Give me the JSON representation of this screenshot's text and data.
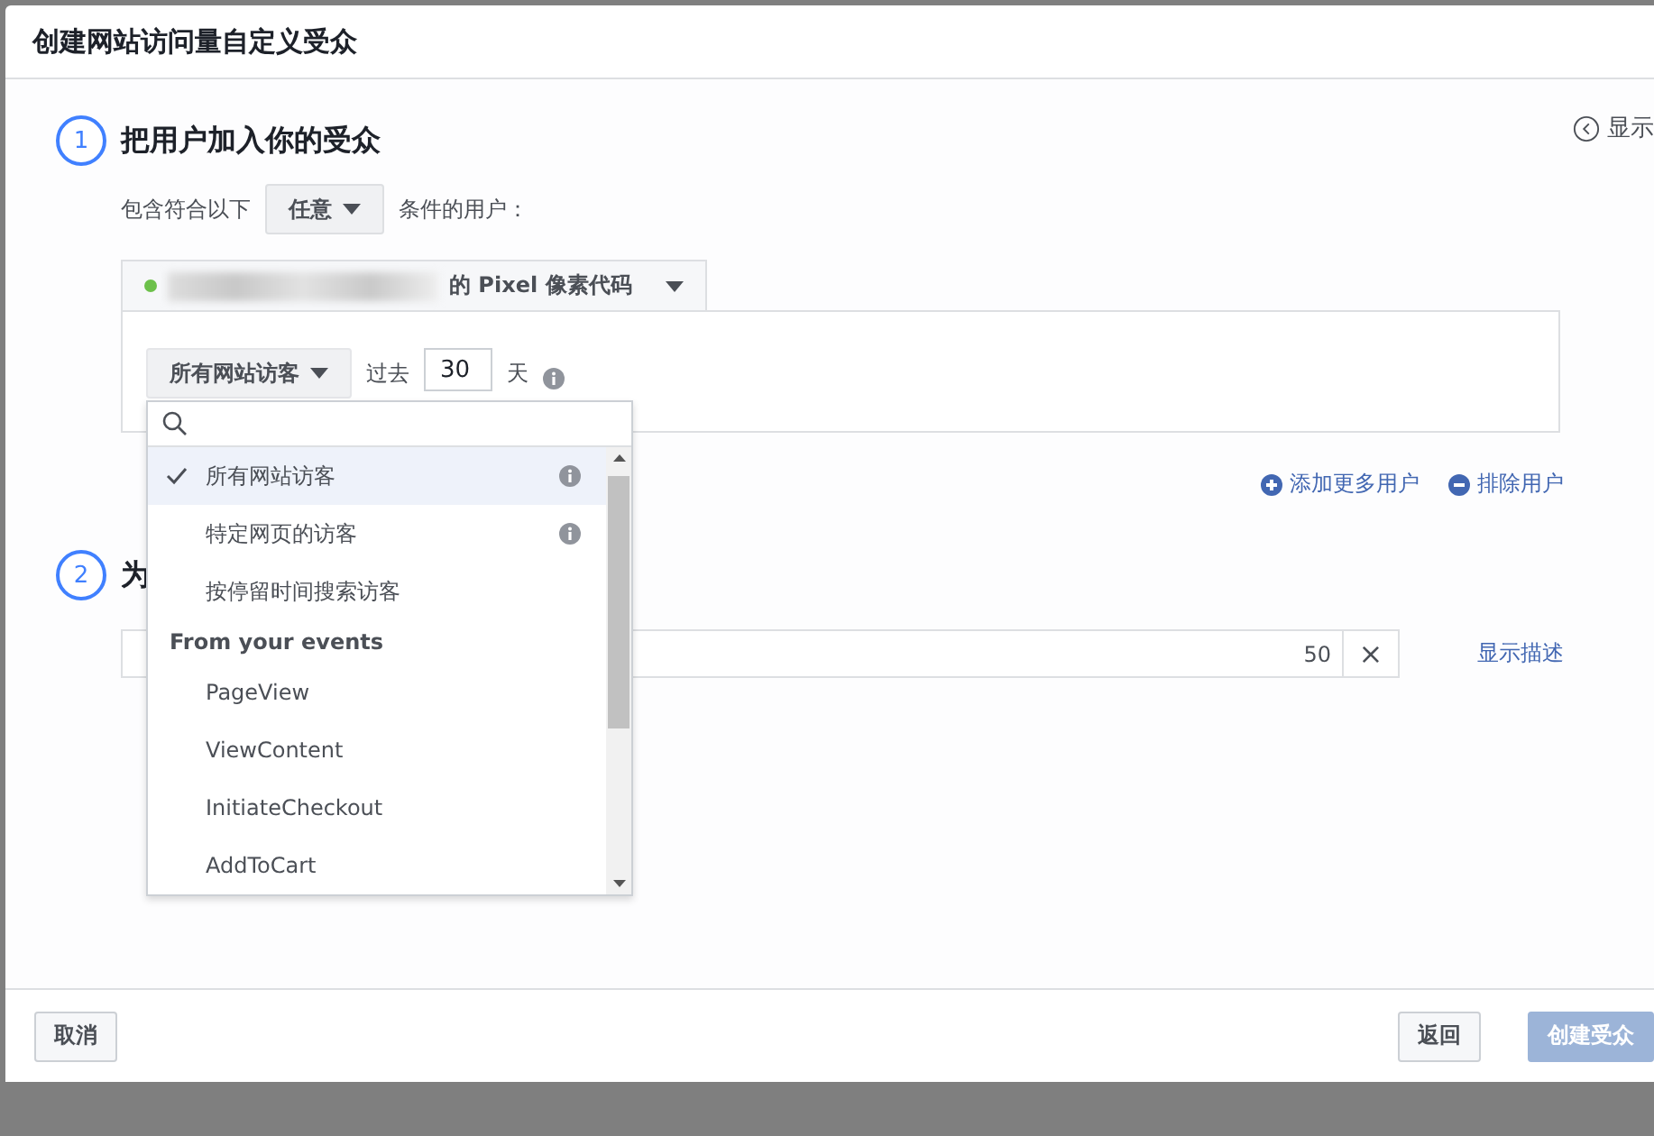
{
  "dialog": {
    "title": "创建网站访问量自定义受众"
  },
  "side_toggle": {
    "label": "显示"
  },
  "step1": {
    "number": "1",
    "title": "把用户加入你的受众",
    "include_prefix": "包含符合以下",
    "include_select": "任意",
    "include_suffix": "条件的用户：",
    "pixel": {
      "label": "的 Pixel 像素代码"
    },
    "rule": {
      "audience_select": "所有网站访客",
      "past_label": "过去",
      "days_value": "30",
      "days_unit": "天"
    },
    "links": [
      {
        "kind": "add",
        "label": "添加更多用户"
      },
      {
        "kind": "exclude",
        "label": "排除用户"
      }
    ]
  },
  "step2": {
    "number": "2",
    "title": "为",
    "counter": "50",
    "clear": "×",
    "describe_link": "显示描述"
  },
  "dropdown": {
    "items": [
      {
        "kind": "option",
        "label": "所有网站访客",
        "selected": true,
        "info": true
      },
      {
        "kind": "option",
        "label": "特定网页的访客",
        "selected": false,
        "info": true
      },
      {
        "kind": "option",
        "label": "按停留时间搜索访客",
        "selected": false,
        "info": false
      },
      {
        "kind": "header",
        "label": "From your events"
      },
      {
        "kind": "option",
        "label": "PageView",
        "selected": false,
        "info": false
      },
      {
        "kind": "option",
        "label": "ViewContent",
        "selected": false,
        "info": false
      },
      {
        "kind": "option",
        "label": "InitiateCheckout",
        "selected": false,
        "info": false
      },
      {
        "kind": "option",
        "label": "AddToCart",
        "selected": false,
        "info": false
      }
    ]
  },
  "footer": {
    "buttons": [
      {
        "kind": "cancel",
        "label": "取消"
      },
      {
        "kind": "back",
        "label": "返回"
      },
      {
        "kind": "primary",
        "label": "创建受众",
        "disabled": true
      }
    ]
  }
}
